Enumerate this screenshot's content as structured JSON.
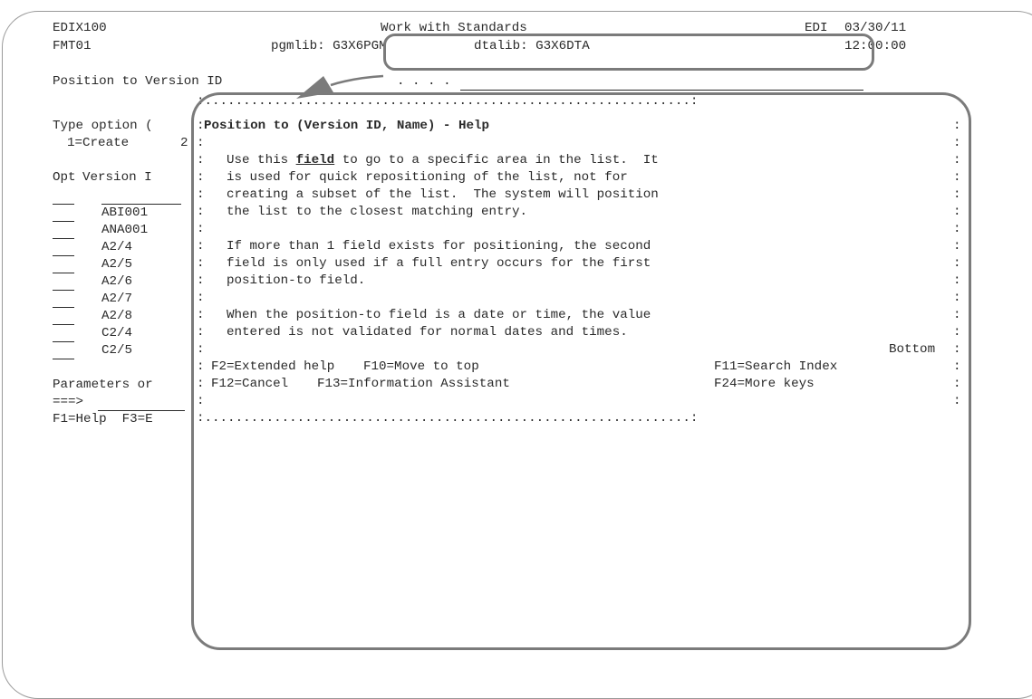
{
  "header": {
    "program": "EDIX100",
    "title": "Work with Standards",
    "system": "EDI",
    "date": "03/30/11",
    "format": "FMT01",
    "pgmlib": "pgmlib: G3X6PGM",
    "dtalib": "dtalib: G3X6DTA",
    "time": "12:00:00"
  },
  "position_to": {
    "label": "Position to Version ID",
    "dots": ". . . .",
    "value": ""
  },
  "background": {
    "type_option": "Type option (",
    "option_1": "1=Create",
    "option_2": "2",
    "opt_col": "Opt",
    "version_col": "Version I",
    "rows": [
      {
        "opt": "",
        "version": ""
      },
      {
        "opt": "",
        "version": "ABI001"
      },
      {
        "opt": "",
        "version": "ANA001"
      },
      {
        "opt": "",
        "version": "A2/4"
      },
      {
        "opt": "",
        "version": "A2/5"
      },
      {
        "opt": "",
        "version": "A2/6"
      },
      {
        "opt": "",
        "version": "A2/7"
      },
      {
        "opt": "",
        "version": "A2/8"
      },
      {
        "opt": "",
        "version": "C2/4"
      },
      {
        "opt": "",
        "version": "C2/5"
      }
    ],
    "parameters": "Parameters or",
    "command_prompt": "===>",
    "function_keys": "F1=Help  F3=E"
  },
  "help_window": {
    "top_border": ":...............................................................:",
    "title": "Position to (Version ID, Name) - Help",
    "para1_line1_a": "Use this ",
    "para1_line1_link": "field",
    "para1_line1_b": " to go to a specific area in the list.  It",
    "para1_line2": "is used for quick repositioning of the list, not for",
    "para1_line3": "creating a subset of the list.  The system will position",
    "para1_line4": "the list to the closest matching entry.",
    "para2_line1": "If more than 1 field exists for positioning, the second",
    "para2_line2": "field is only used if a full entry occurs for the first",
    "para2_line3": "position-to field.",
    "para3_line1": "When the position-to field is a date or time, the value",
    "para3_line2": "entered is not validated for normal dates and times.",
    "bottom_indicator": "Bottom",
    "keys_line1_a": "F2=Extended help",
    "keys_line1_b": "F10=Move to top",
    "keys_line1_c": "F11=Search Index",
    "keys_line2_a": "F12=Cancel",
    "keys_line2_b": "F13=Information Assistant",
    "keys_line2_c": "F24=More keys",
    "bottom_border": ":...............................................................:",
    "colon": ":"
  }
}
